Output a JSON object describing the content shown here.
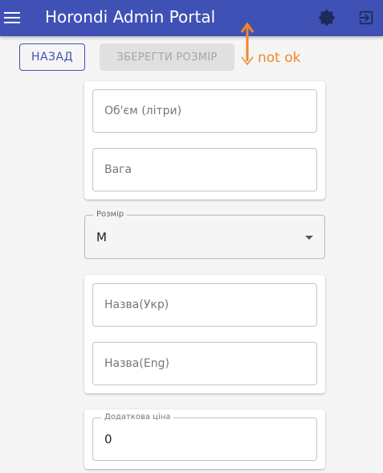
{
  "appbar": {
    "title": "Horondi Admin Portal",
    "bg_color": "#3f51b5",
    "icons": [
      "menu-icon",
      "theme-toggle-icon",
      "logout-icon"
    ]
  },
  "actions": {
    "back_label": "НАЗАД",
    "save_label": "ЗБЕРЕГТИ РОЗМІР"
  },
  "annotation": {
    "text": "not ok",
    "color": "#f2862b"
  },
  "form": {
    "volume_placeholder": "Об'єм (літри)",
    "weight_placeholder": "Вага",
    "size_label": "Розмір",
    "size_value": "M",
    "name_ua_placeholder": "Назва(Укр)",
    "name_en_placeholder": "Назва(Eng)",
    "extra_price_label": "Додаткова ціна",
    "extra_price_value": "0"
  }
}
